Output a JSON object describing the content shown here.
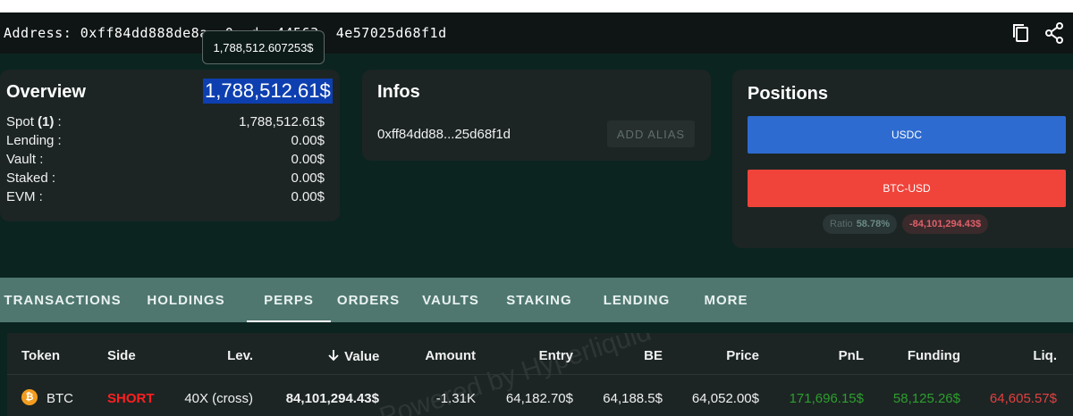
{
  "address": {
    "text": "Address: 0xff84dd888de8a  0  d  44563  4e57025d68f1d",
    "copy_icon": "copy-icon",
    "share_icon": "share-icon"
  },
  "tooltip": {
    "value": "1,788,512.607253$"
  },
  "overview": {
    "title": "Overview",
    "total": "1,788,512.61$",
    "rows": [
      {
        "label": "Spot ",
        "count": "(1)",
        "suffix": " :",
        "value": "1,788,512.61$"
      },
      {
        "label": "Lending :",
        "value": "0.00$"
      },
      {
        "label": "Vault :",
        "value": "0.00$"
      },
      {
        "label": "Staked :",
        "value": "0.00$"
      },
      {
        "label": "EVM :",
        "value": "0.00$"
      }
    ]
  },
  "infos": {
    "title": "Infos",
    "address_short": "0xff84dd88...25d68f1d",
    "alias_button": "ADD ALIAS"
  },
  "positions": {
    "title": "Positions",
    "bars": [
      {
        "label": "USDC",
        "color": "#2d6bd0"
      },
      {
        "label": "BTC-USD",
        "color": "#f0433a"
      }
    ],
    "ratio_label": "Ratio",
    "ratio_value": "58.78%",
    "pnl": "-84,101,294.43$"
  },
  "tabs": [
    "TRANSACTIONS",
    "HOLDINGS",
    "PERPS",
    "ORDERS",
    "VAULTS",
    "STAKING",
    "LENDING",
    "MORE"
  ],
  "active_tab": "PERPS",
  "table": {
    "watermark": "Powered by Hyperliquid",
    "headers": [
      "Token",
      "Side",
      "Lev.",
      "Value",
      "Amount",
      "Entry",
      "BE",
      "Price",
      "PnL",
      "Funding",
      "Liq."
    ],
    "sort_icon": "arrow-down-icon",
    "rows": [
      {
        "token": "BTC",
        "side": "SHORT",
        "lev": "40X (cross)",
        "value": "84,101,294.43$",
        "amount": "-1.31K",
        "entry": "64,182.70$",
        "be": "64,188.5$",
        "price": "64,052.00$",
        "pnl": "171,696.15$",
        "funding": "58,125.26$",
        "liq": "64,605.57$"
      }
    ]
  },
  "colors": {
    "short": "#ff1f1f",
    "positive": "#2e9e2e",
    "liq": "#e34040"
  }
}
